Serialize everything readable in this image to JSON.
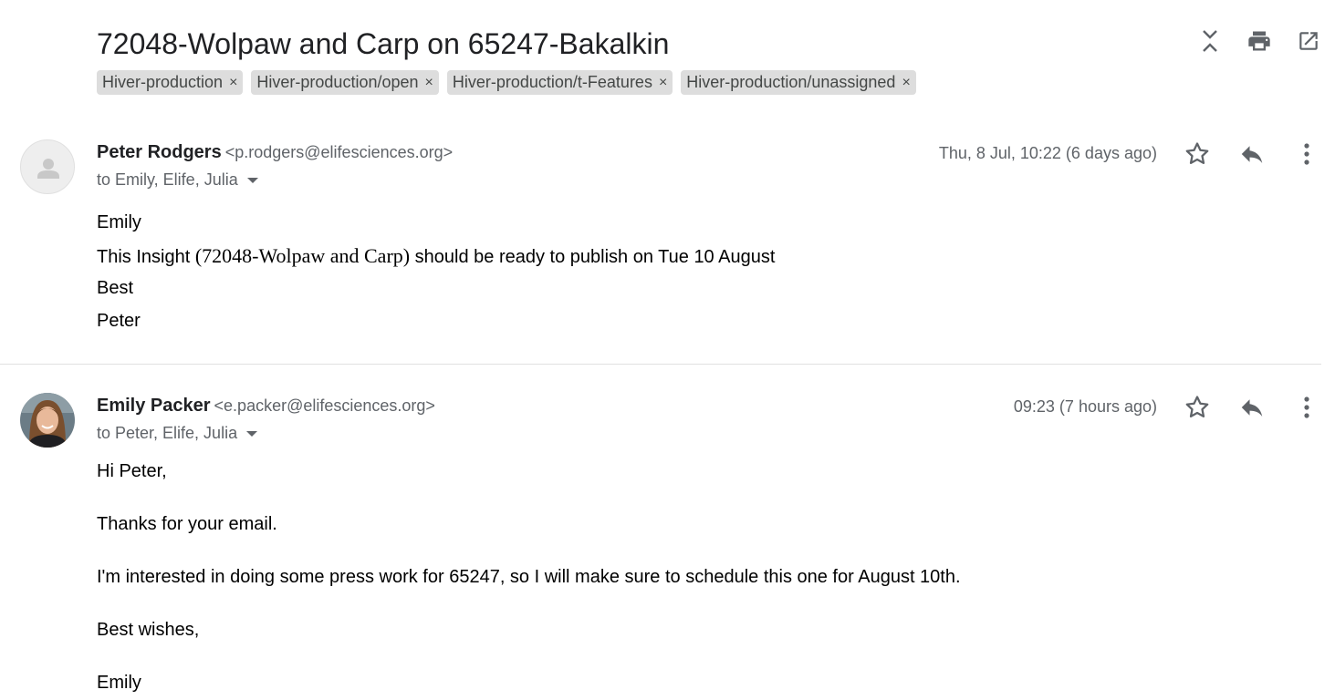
{
  "thread": {
    "subject": "72048-Wolpaw and Carp on 65247-Bakalkin",
    "labels": [
      "Hiver-production",
      "Hiver-production/open",
      "Hiver-production/t-Features",
      "Hiver-production/unassigned"
    ],
    "label_remove_glyph": "×"
  },
  "toolbar_icons": [
    "expand-collapse-icon",
    "print-icon",
    "open-in-new-window-icon"
  ],
  "messages": [
    {
      "sender_name": "Peter Rodgers",
      "sender_email": "<p.rodgers@elifesciences.org>",
      "recipients": "to Emily, Elife, Julia",
      "date": "Thu, 8 Jul, 10:22 (6 days ago)",
      "body": {
        "greeting": "Emily",
        "line_prefix": "This Insight ",
        "line_ref": "(72048-Wolpaw and Carp)",
        "line_suffix": " should be ready to publish on Tue 10 August",
        "signoff": "Best",
        "signature": "Peter"
      }
    },
    {
      "sender_name": "Emily Packer",
      "sender_email": "<e.packer@elifesciences.org>",
      "recipients": "to Peter, Elife, Julia",
      "date": "09:23 (7 hours ago)",
      "body": {
        "greeting": "Hi Peter,",
        "thanks": "Thanks for your email.",
        "main": "I'm interested in doing some press work for 65247, so I will make sure to schedule this one for August 10th.",
        "signoff": "Best wishes,",
        "signature": "Emily"
      }
    }
  ],
  "colors": {
    "chip_bg": "#dddddd",
    "icon_gray": "#5f6368",
    "text": "#202124"
  }
}
